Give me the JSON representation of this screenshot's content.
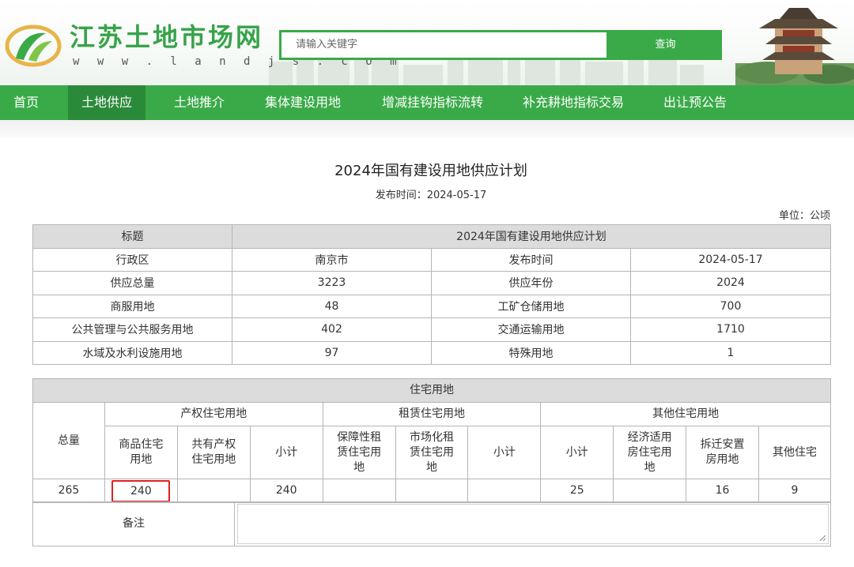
{
  "site": {
    "name": "江苏土地市场网",
    "url": "w w w . l a n d j s . c o m"
  },
  "search": {
    "placeholder": "请输入关键字",
    "button": "查询"
  },
  "nav": {
    "items": [
      "首页",
      "土地供应",
      "土地推介",
      "集体建设用地",
      "增减挂钩指标流转",
      "补充耕地指标交易",
      "出让预公告"
    ],
    "active_index": 1
  },
  "article": {
    "title": "2024年国有建设用地供应计划",
    "publish_label": "发布时间：",
    "publish_date": "2024-05-17",
    "unit": "单位：公顷"
  },
  "info_table": {
    "title_label": "标题",
    "title_value": "2024年国有建设用地供应计划",
    "rows": [
      {
        "k1": "行政区",
        "v1": "南京市",
        "k2": "发布时间",
        "v2": "2024-05-17"
      },
      {
        "k1": "供应总量",
        "v1": "3223",
        "k2": "供应年份",
        "v2": "2024"
      },
      {
        "k1": "商服用地",
        "v1": "48",
        "k2": "工矿仓储用地",
        "v2": "700"
      },
      {
        "k1": "公共管理与公共服务用地",
        "v1": "402",
        "k2": "交通运输用地",
        "v2": "1710"
      },
      {
        "k1": "水域及水利设施用地",
        "v1": "97",
        "k2": "特殊用地",
        "v2": "1"
      }
    ]
  },
  "residential": {
    "title": "住宅用地",
    "total_label": "总量",
    "group1": "产权住宅用地",
    "group2": "租赁住宅用地",
    "group3": "其他住宅用地",
    "cols": {
      "commodity": "商品住宅用地",
      "shared": "共有产权住宅用地",
      "subtotal1": "小计",
      "affordable_rent": "保障性租赁住宅用地",
      "market_rent": "市场化租赁住宅用地",
      "subtotal2": "小计",
      "subtotal3": "小计",
      "economic": "经济适用房住宅用地",
      "relocation": "拆迁安置房用地",
      "other": "其他住宅"
    },
    "values": {
      "total": "265",
      "commodity": "240",
      "shared": "",
      "subtotal1": "240",
      "affordable_rent": "",
      "market_rent": "",
      "subtotal2": "",
      "subtotal3": "25",
      "economic": "",
      "relocation": "16",
      "other": "9"
    },
    "remark_label": "备注"
  },
  "colors": {
    "brand_green": "#3aaa48",
    "nav_active": "#2b8a3a",
    "highlight_red": "#e02020"
  }
}
